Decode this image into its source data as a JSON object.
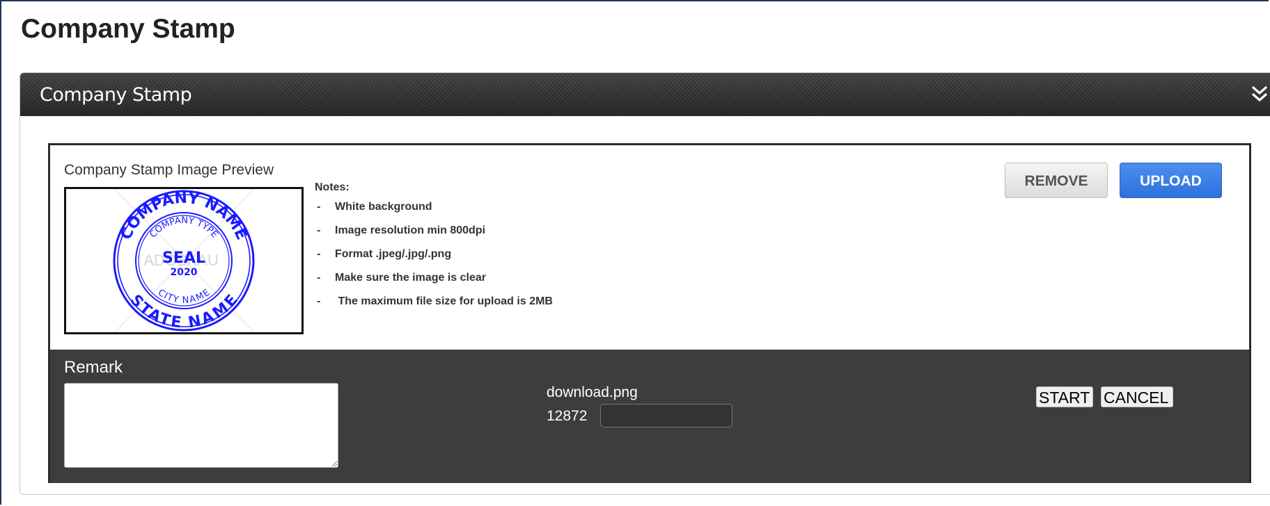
{
  "page": {
    "title": "Company Stamp"
  },
  "panel": {
    "header_title": "Company Stamp",
    "collapse_icon": "double-chevron-down-icon"
  },
  "preview": {
    "label": "Company Stamp Image Preview",
    "stamp": {
      "top_text": "COMPANY NAME",
      "inner_top_text": "COMPANY TYPE",
      "center_text": "SEAL",
      "year": "2020",
      "inner_bottom_text": "CITY NAME",
      "bottom_text": "STATE NAME",
      "watermark": "ADOSKAU",
      "color": "#1a1aff"
    }
  },
  "notes": {
    "title": "Notes:",
    "items": [
      "White background",
      "Image resolution min 800dpi",
      "Format .jpeg/.jpg/.png",
      "Make sure the image is clear",
      "The maximum file size for upload is 2MB"
    ]
  },
  "buttons": {
    "remove": "REMOVE",
    "upload": "UPLOAD"
  },
  "remark": {
    "label": "Remark",
    "value": ""
  },
  "file": {
    "name": "download.png",
    "size": "12872",
    "progress": 0,
    "start_label": "START",
    "cancel_label": "CANCEL"
  },
  "colors": {
    "upload": "#2d72dc",
    "header": "#2a2a2a",
    "bottom": "#3d3d3d"
  }
}
